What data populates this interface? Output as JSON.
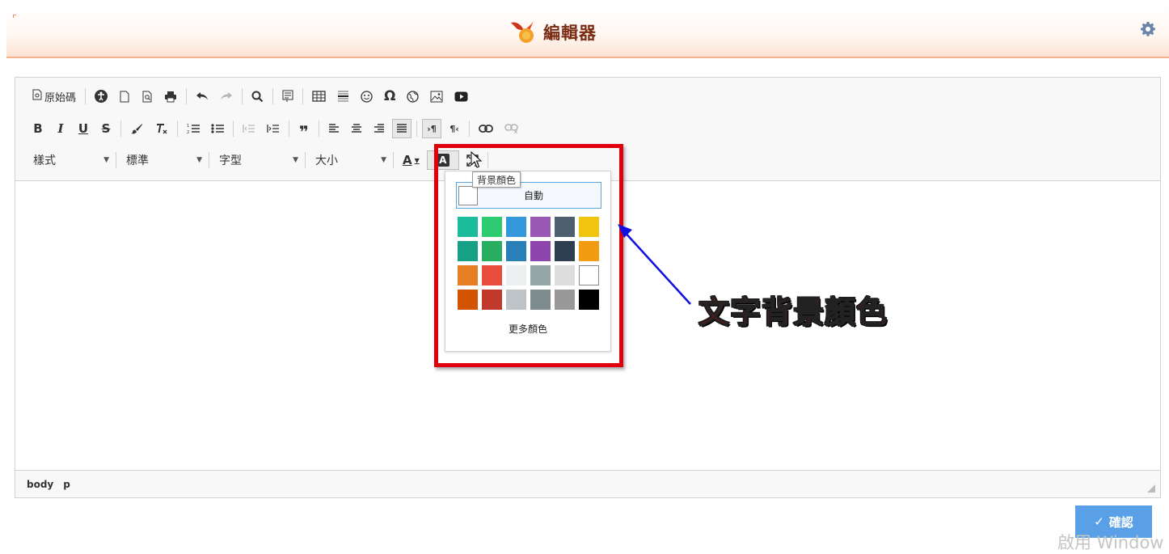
{
  "header": {
    "title": "編輯器"
  },
  "toolbar": {
    "source_label": "原始碼",
    "combos": {
      "style": "樣式",
      "format": "標準",
      "font": "字型",
      "size": "大小"
    }
  },
  "statusbar": {
    "path": [
      "body",
      "p"
    ]
  },
  "tooltip": "背景顏色",
  "color_panel": {
    "auto_label": "自動",
    "more_label": "更多顏色",
    "colors": [
      "#1abc9c",
      "#2ecc71",
      "#3498db",
      "#9b59b6",
      "#4e5f70",
      "#f1c40f",
      "#16a085",
      "#27ae60",
      "#2980b9",
      "#8e44ad",
      "#2c3e50",
      "#f39c12",
      "#e67e22",
      "#e74c3c",
      "#ecf0f1",
      "#95a5a6",
      "#dddddd",
      "#ffffff",
      "#d35400",
      "#c0392b",
      "#bdc3c7",
      "#7f8c8d",
      "#999999",
      "#000000"
    ]
  },
  "annotation": {
    "callout": "文字背景顏色"
  },
  "confirm_label": "確認",
  "watermark": "啟用 Window"
}
